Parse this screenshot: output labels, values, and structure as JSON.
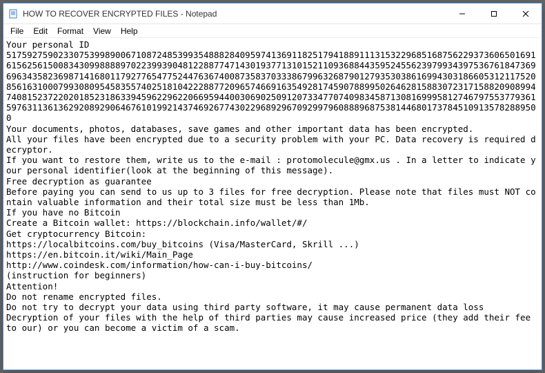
{
  "window": {
    "title": "HOW TO RECOVER ENCRYPTED FILES - Notepad",
    "icon_name": "notepad-icon"
  },
  "menu": {
    "items": [
      "File",
      "Edit",
      "Format",
      "View",
      "Help"
    ]
  },
  "note": {
    "personal_id_label": "Your personal ID",
    "personal_id": "5175927590233075399890067108724853993548882840959741369118251794188911131532296851687562293736065016916156256150083430998888970223993904812288774714301937713101521109368844359524556239799343975367618473696963435823698714168011792776547752447636740087358370333867996326879012793530386169943031866053121175208561631000799308095458355740251810422288772096574669163549281745907889950264628158830723171588209089947408152372202018523186339459622962206695944003069025091207334770740983458713081699958127467975537793615976311361362920892906467610199214374692677430229689296709299796088896875381446801737845109135782889500",
    "body_lines": [
      "",
      "Your documents, photos, databases, save games and other important data has been encrypted.",
      "All your files have been encrypted due to a security problem with your PC. Data recovery is required decryptor.",
      "If you want to restore them, write us to the e-mail : protomolecule@gmx.us . In a letter to indicate your personal identifier(look at the beginning of this message).",
      "Free decryption as guarantee",
      "Before paying you can send to us up to 3 files for free decryption. Please note that files must NOT contain valuable information and their total size must be less than 1Mb.",
      "If you have no Bitcoin",
      "Create a Bitcoin wallet: https://blockchain.info/wallet/#/",
      "Get cryptocurrency Bitcoin:",
      "https://localbitcoins.com/buy_bitcoins (Visa/MasterCard, Skrill ...)",
      "https://en.bitcoin.it/wiki/Main_Page",
      "http://www.coindesk.com/information/how-can-i-buy-bitcoins/",
      "(instruction for beginners)",
      "",
      "Attention!",
      "Do not rename encrypted files.",
      "Do not try to decrypt your data using third party software, it may cause permanent data loss",
      "Decryption of your files with the help of third parties may cause increased price (they add their fee to our) or you can become a victim of a scam."
    ]
  }
}
